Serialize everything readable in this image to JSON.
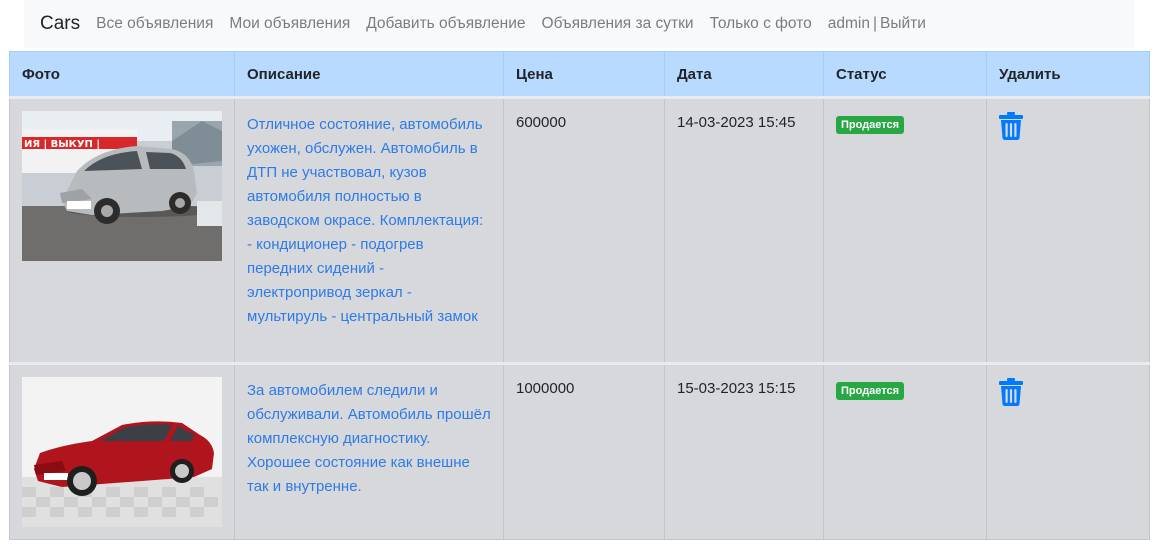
{
  "navbar": {
    "brand": "Cars",
    "links": {
      "all_ads": "Все объявления",
      "my_ads": "Мои объявления",
      "add_ad": "Добавить объявление",
      "daily_ads": "Объявления за сутки",
      "photo_only": "Только с фото"
    },
    "user": "admin",
    "separator": "|",
    "logout": "Выйти"
  },
  "table": {
    "headers": {
      "photo": "Фото",
      "description": "Описание",
      "price": "Цена",
      "date": "Дата",
      "status": "Статус",
      "delete": "Удалить"
    },
    "rows": [
      {
        "photo_icon": "car-photo-silver-hatchback",
        "description": "Отличное состояние, автомобиль ухожен, обслужен. Автомобиль в ДТП не участвовал, кузов автомобиля полностью в заводском окрасе. Комплектация: - кондиционер - подогрев передних сидений - электропривод зеркал - мультируль - центральный замок",
        "price": "600000",
        "date": "14-03-2023 15:45",
        "status": "Продается",
        "delete_icon": "trash-icon"
      },
      {
        "photo_icon": "car-photo-red-sedan",
        "description": "За автомобилем следили и обслуживали. Автомобиль прошёл комплексную диагностику. Хорошее состояние как внешне так и внутренне.",
        "price": "1000000",
        "date": "15-03-2023 15:15",
        "status": "Продается",
        "delete_icon": "trash-icon"
      }
    ]
  },
  "colors": {
    "header_bg": "#b8daff",
    "row_bg": "#d6d8db",
    "link": "#2e7be6",
    "badge": "#28a745",
    "trash": "#007bff"
  }
}
